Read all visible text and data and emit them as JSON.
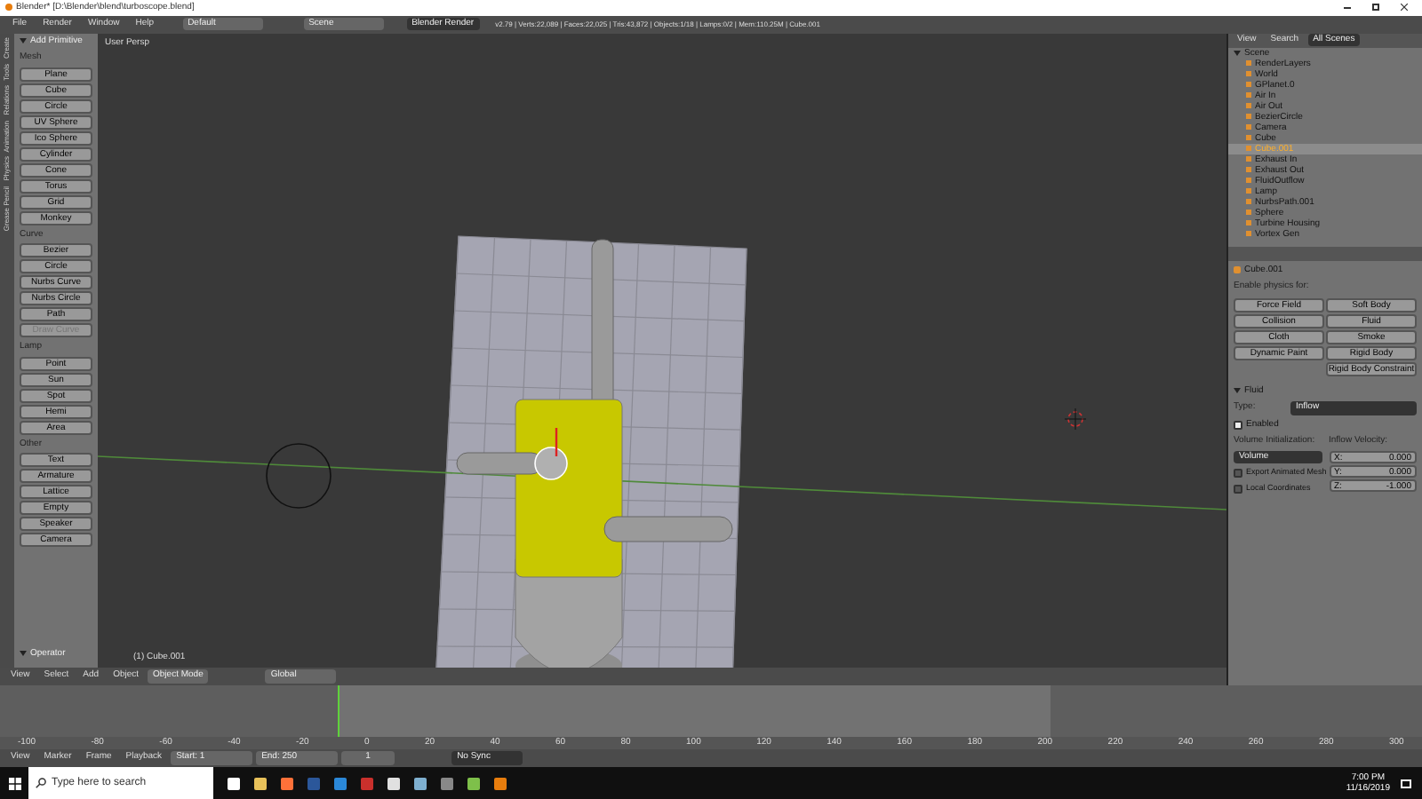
{
  "window": {
    "title": "Blender* [D:\\Blender\\blend\\turboscope.blend]"
  },
  "menu": [
    "File",
    "Render",
    "Window",
    "Help"
  ],
  "layout": "Default",
  "scene": "Scene",
  "engine": "Blender Render",
  "stats": "v2.79 | Verts:22,089 | Faces:22,025 | Tris:43,872 | Objects:1/18 | Lamps:0/2 | Mem:110.25M | Cube.001",
  "toolbar": {
    "tabs": [
      "Create",
      "Tools",
      "Relations",
      "Animation",
      "Physics",
      "Grease Pencil"
    ],
    "title": "Add Primitive",
    "groups": [
      {
        "heading": "Mesh",
        "items": [
          {
            "label": "Plane",
            "disabled": false
          },
          {
            "label": "Cube",
            "disabled": false
          },
          {
            "label": "Circle",
            "disabled": false
          },
          {
            "label": "UV Sphere",
            "disabled": false
          },
          {
            "label": "Ico Sphere",
            "disabled": false
          },
          {
            "label": "Cylinder",
            "disabled": false
          },
          {
            "label": "Cone",
            "disabled": false
          },
          {
            "label": "Torus",
            "disabled": false
          },
          {
            "label": "Grid",
            "disabled": false
          },
          {
            "label": "Monkey",
            "disabled": false
          }
        ]
      },
      {
        "heading": "Curve",
        "items": [
          {
            "label": "Bezier",
            "disabled": false
          },
          {
            "label": "Circle",
            "disabled": false
          },
          {
            "label": "Nurbs Curve",
            "disabled": false
          },
          {
            "label": "Nurbs Circle",
            "disabled": false
          },
          {
            "label": "Path",
            "disabled": false
          },
          {
            "label": "Draw Curve",
            "disabled": true
          }
        ]
      },
      {
        "heading": "Lamp",
        "items": [
          {
            "label": "Point",
            "disabled": false
          },
          {
            "label": "Sun",
            "disabled": false
          },
          {
            "label": "Spot",
            "disabled": false
          },
          {
            "label": "Hemi",
            "disabled": false
          },
          {
            "label": "Area",
            "disabled": false
          }
        ]
      },
      {
        "heading": "Other",
        "items": [
          {
            "label": "Text",
            "disabled": false
          },
          {
            "label": "Armature",
            "disabled": false
          },
          {
            "label": "Lattice",
            "disabled": false
          },
          {
            "label": "Empty",
            "disabled": false
          },
          {
            "label": "Speaker",
            "disabled": false
          },
          {
            "label": "Camera",
            "disabled": false
          }
        ]
      }
    ],
    "operator": "Operator"
  },
  "viewport": {
    "view_name": "User Persp",
    "object_label": "(1) Cube.001"
  },
  "viewport_header": {
    "menus": [
      "View",
      "Select",
      "Add",
      "Object"
    ],
    "mode": "Object Mode",
    "orientation": "Global"
  },
  "outliner": {
    "menus": [
      "View",
      "Search"
    ],
    "filter": "All Scenes",
    "scene": "Scene",
    "items": [
      {
        "name": "RenderLayers",
        "selected": false
      },
      {
        "name": "World",
        "selected": false
      },
      {
        "name": "GPlanet.0",
        "selected": false
      },
      {
        "name": "Air In",
        "selected": false
      },
      {
        "name": "Air Out",
        "selected": false
      },
      {
        "name": "BezierCircle",
        "selected": false
      },
      {
        "name": "Camera",
        "selected": false
      },
      {
        "name": "Cube",
        "selected": false
      },
      {
        "name": "Cube.001",
        "selected": true
      },
      {
        "name": "Exhaust In",
        "selected": false
      },
      {
        "name": "Exhaust Out",
        "selected": false
      },
      {
        "name": "FluidOutflow",
        "selected": false
      },
      {
        "name": "Lamp",
        "selected": false
      },
      {
        "name": "NurbsPath.001",
        "selected": false
      },
      {
        "name": "Sphere",
        "selected": false
      },
      {
        "name": "Turbine Housing",
        "selected": false
      },
      {
        "name": "Vortex Gen",
        "selected": false
      }
    ]
  },
  "properties": {
    "object": "Cube.001",
    "physics_heading": "Enable physics for:",
    "physics_buttons": [
      "Force Field",
      "Soft Body",
      "Collision",
      "Fluid",
      "Cloth",
      "Smoke",
      "Dynamic Paint",
      "Rigid Body",
      "Rigid Body Constraint"
    ],
    "panel": {
      "title": "Fluid",
      "expanded": true,
      "type_label": "Type:",
      "type": "Inflow",
      "enabled": {
        "label": "Enabled",
        "checked": true
      },
      "volume_label": "Volume Initialization:",
      "volume": "Volume",
      "velocity_label": "Inflow Velocity:",
      "velocity": [
        {
          "axis": "X:",
          "value": "0.000"
        },
        {
          "axis": "Y:",
          "value": "0.000"
        },
        {
          "axis": "Z:",
          "value": "-1.000"
        }
      ],
      "options": [
        {
          "label": "Export Animated Mesh",
          "checked": false
        },
        {
          "label": "Local Coordinates",
          "checked": false
        }
      ]
    }
  },
  "timeline": {
    "ticks": [
      "-100",
      "-80",
      "-60",
      "-40",
      "-20",
      "0",
      "20",
      "40",
      "60",
      "80",
      "100",
      "120",
      "140",
      "160",
      "180",
      "200",
      "220",
      "240",
      "260",
      "280",
      "300"
    ]
  },
  "timeline_header": {
    "menus": [
      "View",
      "Marker",
      "Frame",
      "Playback"
    ],
    "start": "Start: 1",
    "end": "End: 250",
    "frame": "1",
    "sync": "No Sync"
  },
  "taskbar": {
    "search_placeholder": "Type here to search",
    "time": "7:00 PM",
    "date": "11/16/2019"
  }
}
